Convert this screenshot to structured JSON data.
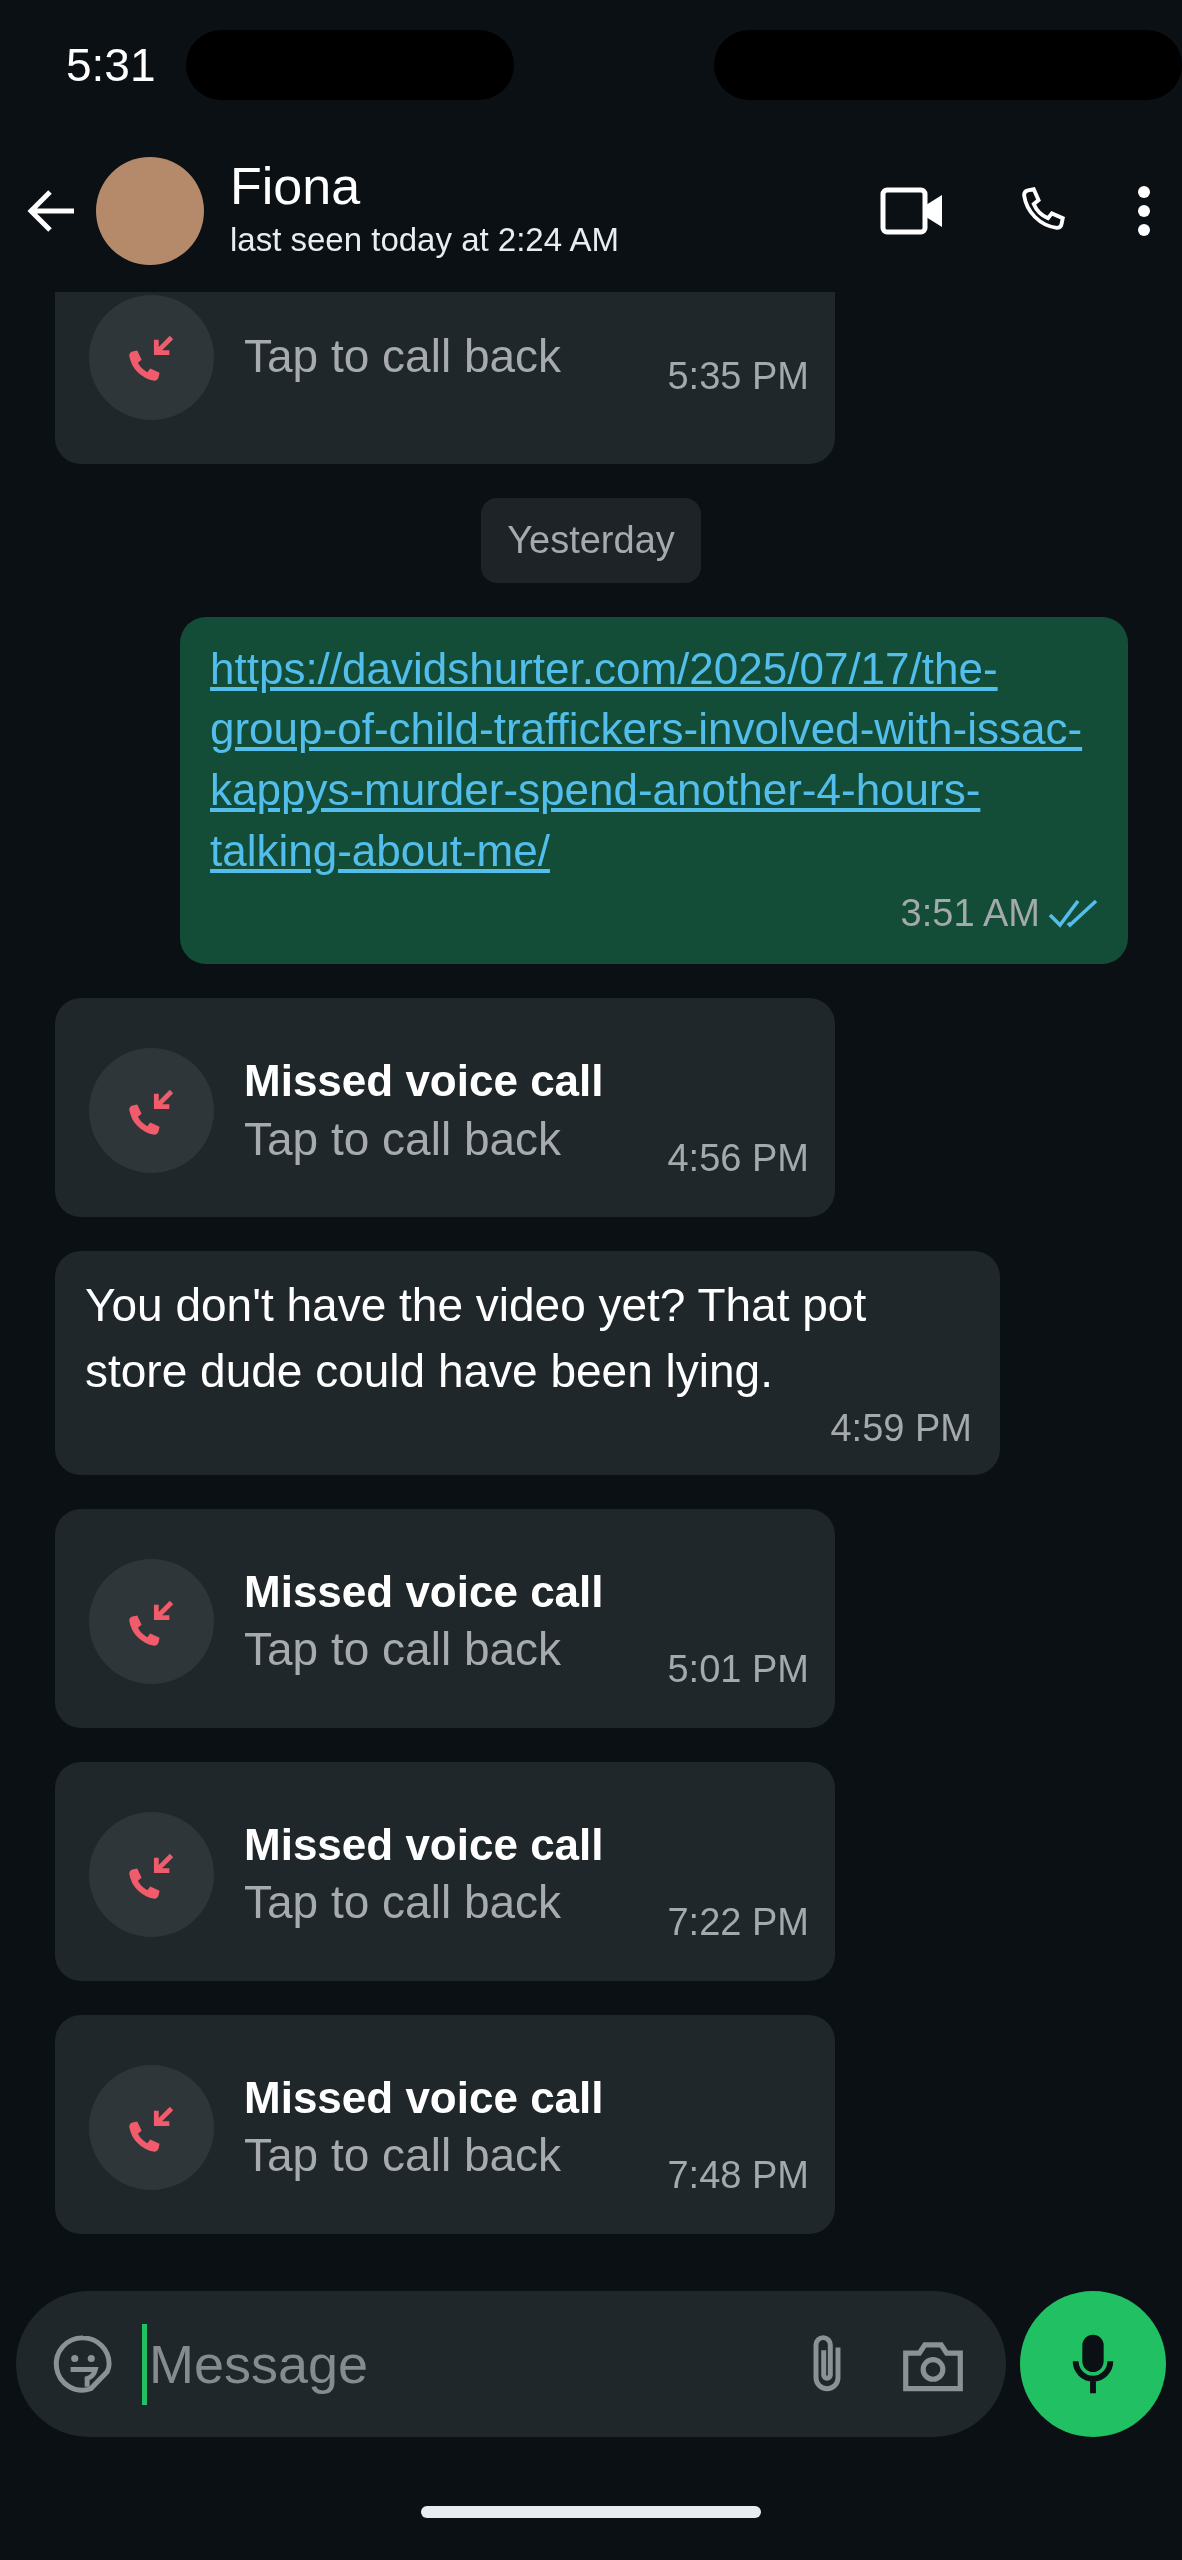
{
  "status_bar": {
    "time": "5:31"
  },
  "header": {
    "name": "Fiona",
    "subtitle": "last seen today at 2:24 AM"
  },
  "messages": [
    {
      "kind": "missed_call",
      "subtitle": "Tap to call back",
      "time": "5:35 PM"
    },
    {
      "kind": "date",
      "text": "Yesterday"
    },
    {
      "kind": "outgoing_link",
      "text": "https://davidshurter.com/2025/07/17/the-group-of-child-traffickers-involved-with-issac-kappys-murder-spend-another-4-hours-talking-about-me/",
      "time": "3:51 AM",
      "read": true
    },
    {
      "kind": "missed_call",
      "title": "Missed voice call",
      "subtitle": "Tap to call back",
      "time": "4:56 PM"
    },
    {
      "kind": "incoming_text",
      "text": "You don't have the video yet? That pot store dude could have been lying.",
      "time": "4:59 PM"
    },
    {
      "kind": "missed_call",
      "title": "Missed voice call",
      "subtitle": "Tap to call back",
      "time": "5:01 PM"
    },
    {
      "kind": "missed_call",
      "title": "Missed voice call",
      "subtitle": "Tap to call back",
      "time": "7:22 PM"
    },
    {
      "kind": "missed_call",
      "title": "Missed voice call",
      "subtitle": "Tap to call back",
      "time": "7:48 PM"
    }
  ],
  "composer": {
    "placeholder": "Message"
  }
}
